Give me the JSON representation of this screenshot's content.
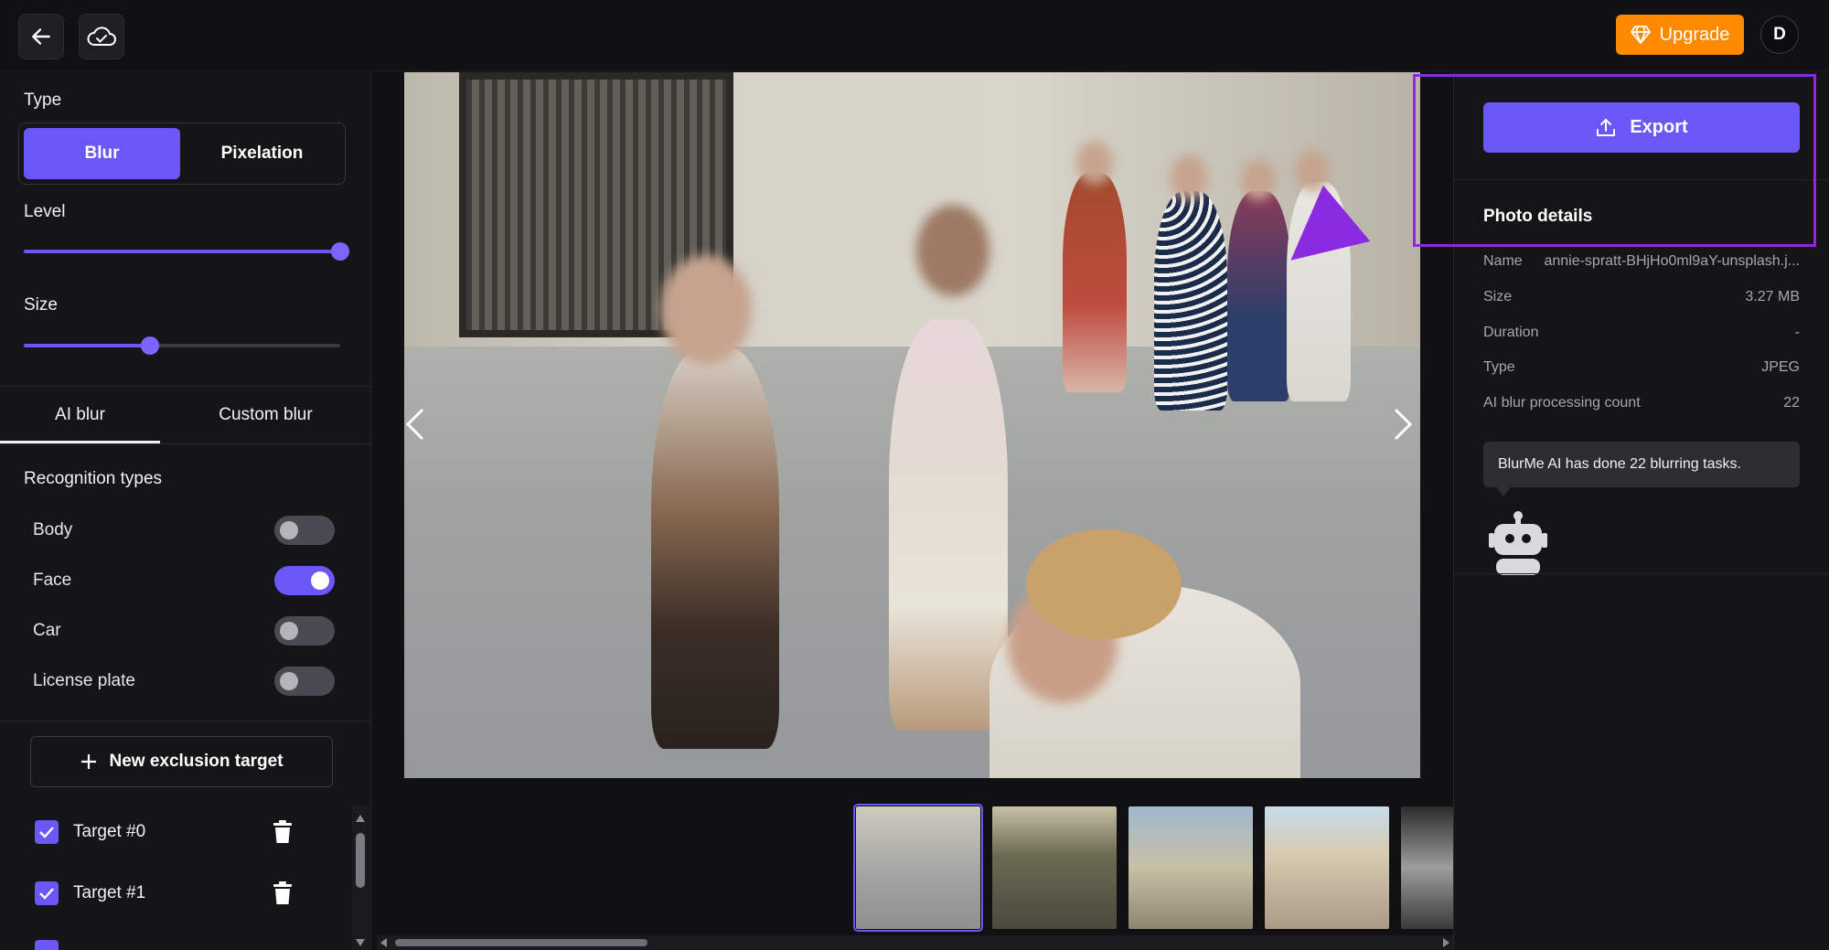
{
  "topbar": {
    "upgrade_label": "Upgrade",
    "avatar_initial": "D"
  },
  "left": {
    "type_label": "Type",
    "type_options": [
      "Blur",
      "Pixelation"
    ],
    "type_selected": "Blur",
    "level_label": "Level",
    "level_value": 1.0,
    "size_label": "Size",
    "size_value": 0.4,
    "tabs": [
      "AI blur",
      "Custom blur"
    ],
    "active_tab": "AI blur",
    "recognition_label": "Recognition types",
    "recognition_types": [
      {
        "label": "Body",
        "on": false
      },
      {
        "label": "Face",
        "on": true
      },
      {
        "label": "Car",
        "on": false
      },
      {
        "label": "License plate",
        "on": false
      }
    ],
    "new_exclusion_label": "New exclusion target",
    "targets": [
      {
        "label": "Target #0",
        "checked": true
      },
      {
        "label": "Target #1",
        "checked": true
      }
    ]
  },
  "right": {
    "export_label": "Export",
    "photo_details_title": "Photo details",
    "details": [
      {
        "key": "Name",
        "value": "annie-spratt-BHjHo0ml9aY-unsplash.j..."
      },
      {
        "key": "Size",
        "value": "3.27 MB"
      },
      {
        "key": "Duration",
        "value": "-"
      },
      {
        "key": "Type",
        "value": "JPEG"
      },
      {
        "key": "AI blur processing count",
        "value": "22"
      }
    ],
    "tip_text": "BlurMe AI has done 22 blurring tasks."
  },
  "colors": {
    "accent": "#6a57f5",
    "upgrade": "#ff8a00",
    "highlight": "#8a2be2"
  },
  "icons": {
    "back": "arrow-left-icon",
    "cloud": "cloud-check-icon",
    "diamond": "diamond-icon",
    "export": "upload-icon",
    "trash": "trash-icon",
    "plus": "plus-icon",
    "robot": "robot-icon"
  }
}
